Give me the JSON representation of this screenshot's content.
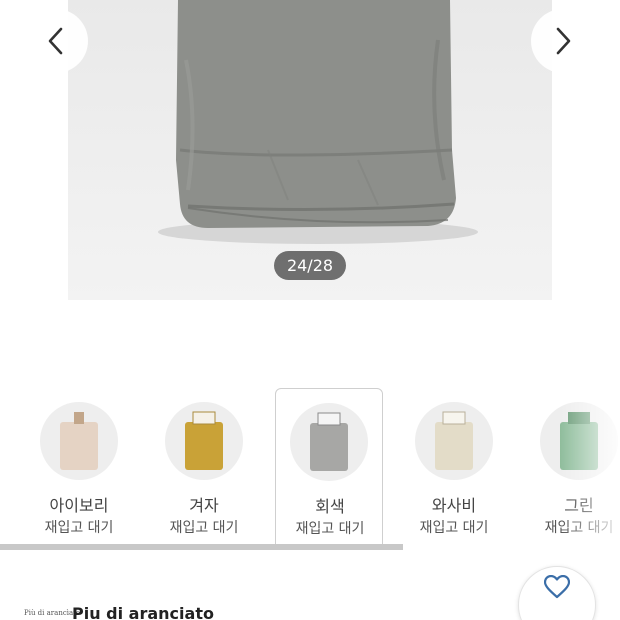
{
  "gallery": {
    "counter": "24/28",
    "prev_icon": "chevron-left-icon",
    "next_icon": "chevron-right-icon"
  },
  "options": [
    {
      "name": "아이보리",
      "status": "재입고 대기",
      "color": "#e5d3c4",
      "selected": false
    },
    {
      "name": "겨자",
      "status": "재입고 대기",
      "color": "#c9a237",
      "selected": false
    },
    {
      "name": "회색",
      "status": "재입고 대기",
      "color": "#a7a7a5",
      "selected": true
    },
    {
      "name": "와사비",
      "status": "재입고 대기",
      "color": "#e3dcc8",
      "selected": false
    },
    {
      "name": "그린",
      "status": "재입고 대기",
      "color": "#8fbd9c",
      "selected": false
    }
  ],
  "shop": {
    "logo_text": "Più di arancìato",
    "name": "Piu di aranciato",
    "like_icon": "heart-outline-icon",
    "accent": "#3b6ea8"
  }
}
